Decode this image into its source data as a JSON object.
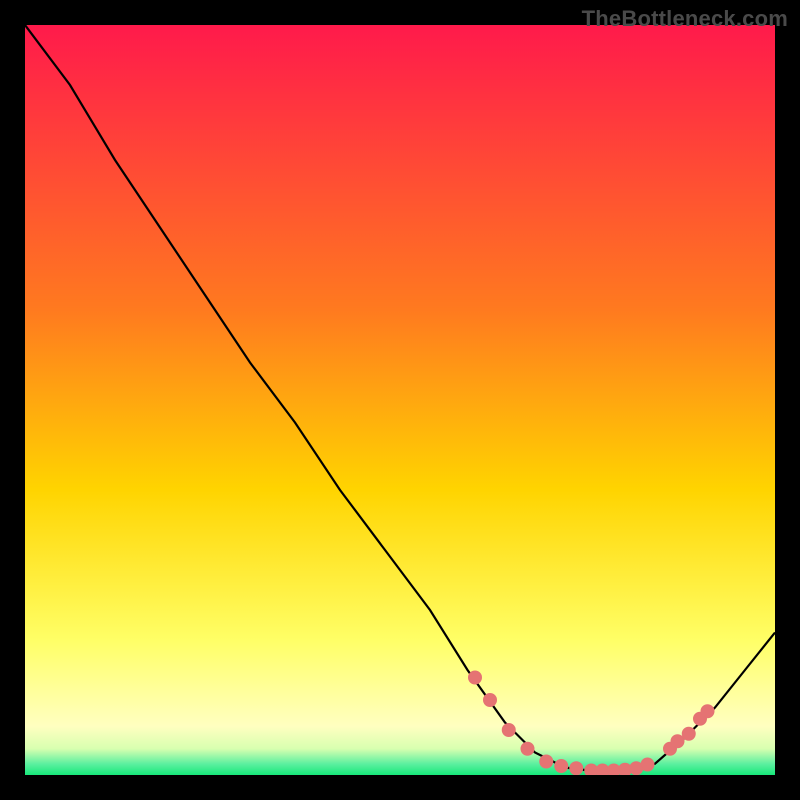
{
  "watermark": "TheBottleneck.com",
  "colors": {
    "bg_top": "#ff1a4b",
    "bg_mid": "#ffd400",
    "bg_lightyellow": "#ffffa0",
    "bg_green": "#17e87a",
    "line": "#000000",
    "marker_fill": "#e57373",
    "marker_stroke": "#e57373",
    "frame": "#000000"
  },
  "chart_data": {
    "type": "line",
    "title": "",
    "xlabel": "",
    "ylabel": "",
    "xlim": [
      0,
      100
    ],
    "ylim": [
      0,
      100
    ],
    "grid": false,
    "curve_comment": "Curve values are read off the figure; y is percent of plot height from bottom, x is percent from left.",
    "curve": [
      {
        "x": 0,
        "y": 100
      },
      {
        "x": 6,
        "y": 92
      },
      {
        "x": 12,
        "y": 82
      },
      {
        "x": 18,
        "y": 73
      },
      {
        "x": 24,
        "y": 64
      },
      {
        "x": 30,
        "y": 55
      },
      {
        "x": 36,
        "y": 47
      },
      {
        "x": 42,
        "y": 38
      },
      {
        "x": 48,
        "y": 30
      },
      {
        "x": 54,
        "y": 22
      },
      {
        "x": 59,
        "y": 14
      },
      {
        "x": 64,
        "y": 7
      },
      {
        "x": 68,
        "y": 3
      },
      {
        "x": 72,
        "y": 1
      },
      {
        "x": 76,
        "y": 0.5
      },
      {
        "x": 80,
        "y": 0.5
      },
      {
        "x": 84,
        "y": 1.5
      },
      {
        "x": 88,
        "y": 5
      },
      {
        "x": 92,
        "y": 9
      },
      {
        "x": 96,
        "y": 14
      },
      {
        "x": 100,
        "y": 19
      }
    ],
    "marker_comment": "Marker positions (x,y in percent) for the dotted/beaded segment near the trough.",
    "markers": [
      {
        "x": 60,
        "y": 13
      },
      {
        "x": 62,
        "y": 10
      },
      {
        "x": 64.5,
        "y": 6
      },
      {
        "x": 67,
        "y": 3.5
      },
      {
        "x": 69.5,
        "y": 1.8
      },
      {
        "x": 71.5,
        "y": 1.2
      },
      {
        "x": 73.5,
        "y": 0.9
      },
      {
        "x": 75.5,
        "y": 0.6
      },
      {
        "x": 77,
        "y": 0.6
      },
      {
        "x": 78.5,
        "y": 0.6
      },
      {
        "x": 80,
        "y": 0.7
      },
      {
        "x": 81.5,
        "y": 0.9
      },
      {
        "x": 83,
        "y": 1.4
      },
      {
        "x": 86,
        "y": 3.5
      },
      {
        "x": 87,
        "y": 4.5
      },
      {
        "x": 88.5,
        "y": 5.5
      },
      {
        "x": 90,
        "y": 7.5
      },
      {
        "x": 91,
        "y": 8.5
      }
    ],
    "gradient_stops": [
      {
        "offset": 0.0,
        "color": "#ff1a4b"
      },
      {
        "offset": 0.38,
        "color": "#ff7a1f"
      },
      {
        "offset": 0.62,
        "color": "#ffd400"
      },
      {
        "offset": 0.82,
        "color": "#ffff66"
      },
      {
        "offset": 0.935,
        "color": "#ffffc0"
      },
      {
        "offset": 0.965,
        "color": "#d8ffb0"
      },
      {
        "offset": 0.985,
        "color": "#5df0a0"
      },
      {
        "offset": 1.0,
        "color": "#17e87a"
      }
    ]
  }
}
